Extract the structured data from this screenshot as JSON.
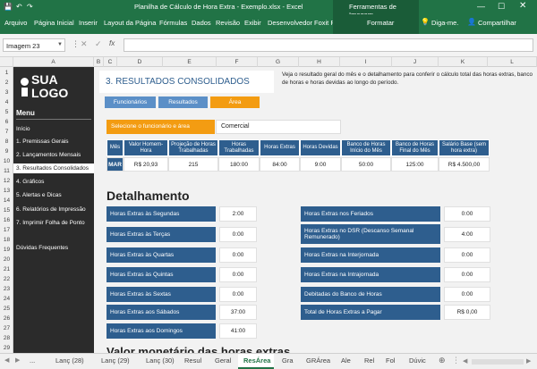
{
  "title_bar": {
    "text": "Planilha de Cálculo de Hora Extra - Exemplo.xlsx - Excel",
    "image_tools": "Ferramentas de Imagem"
  },
  "ribbon": {
    "tabs": [
      "Arquivo",
      "Página Inicial",
      "Inserir",
      "Layout da Página",
      "Fórmulas",
      "Dados",
      "Revisão",
      "Exibir",
      "Desenvolvedor",
      "Foxit PDF",
      "Formatar"
    ],
    "tell_me": "Diga-me.",
    "share": "Compartilhar"
  },
  "formula_bar": {
    "name_box": "Imagem 23",
    "fx": "fx",
    "value": ""
  },
  "columns": [
    "A",
    "B",
    "C",
    "D",
    "E",
    "F",
    "G",
    "H",
    "I",
    "J",
    "K",
    "L"
  ],
  "rows": [
    "1",
    "2",
    "3",
    "4",
    "5",
    "6",
    "7",
    "8",
    "9",
    "10",
    "11",
    "12",
    "13",
    "14",
    "15",
    "16",
    "17",
    "18",
    "19",
    "20",
    "21",
    "22",
    "23",
    "24",
    "25",
    "26",
    "27",
    "28",
    "29"
  ],
  "logo": {
    "line1": "SUA",
    "line2": "LOGO"
  },
  "sidebar": {
    "menu_title": "Menu",
    "items": [
      "Início",
      "1. Premissas Gerais",
      "2. Lançamentos Mensais",
      "3. Resultados Consolidados",
      "4. Gráficos",
      "5. Alertas e Dicas",
      "6. Relatórios de Impressão",
      "7. Imprimir Folha de Ponto",
      "Dúvidas Frequentes"
    ]
  },
  "main": {
    "section_title": "3. RESULTADOS CONSOLIDADOS",
    "description": "Veja o resultado geral do mês e o detalhamento para conferir o cálculo total das horas extras, banco de horas e horas devidas ao longo do período.",
    "buttons": {
      "funcionarios": "Funcionários",
      "resultados": "Resultados",
      "area": "Área"
    },
    "selector": {
      "label": "Selecione o funcionário e área",
      "value": "Comercial"
    },
    "table": {
      "headers": [
        "Mês",
        "Valor Homem-Hora",
        "Projeção de Horas Trabalhadas",
        "Horas Trabalhadas",
        "Horas Extras",
        "Horas Devidas",
        "Banco de Horas Início do Mês",
        "Banco de Horas Final do Mês",
        "Salário Base (sem hora extra)"
      ],
      "row": [
        "MAR",
        "R$ 20,93",
        "215",
        "180:00",
        "84:00",
        "9:00",
        "50:00",
        "125:00",
        "R$ 4.500,00"
      ]
    },
    "detail_title": "Detalhamento",
    "detail_left": [
      {
        "label": "Horas Extras às Segundas",
        "value": "2:00"
      },
      {
        "label": "Horas Extras às Terças",
        "value": "0:00"
      },
      {
        "label": "Horas Extras às Quartas",
        "value": "0:00"
      },
      {
        "label": "Horas Extras às Quintas",
        "value": "0:00"
      },
      {
        "label": "Horas Extras às Sextas",
        "value": "0:00"
      },
      {
        "label": "Horas Extras aos Sábados",
        "value": "37:00"
      },
      {
        "label": "Horas Extras aos Domingos",
        "value": "41:00"
      }
    ],
    "detail_right": [
      {
        "label": "Horas Extras nos Feriados",
        "value": "0:00"
      },
      {
        "label": "Horas Extras no DSR (Descanso Semanal Remunerado)",
        "value": "4:00"
      },
      {
        "label": "Horas Extras na Interjornada",
        "value": "0:00"
      },
      {
        "label": "Horas Extras na Intrajornada",
        "value": "0:00"
      },
      {
        "label": "Debitadas do Banco de Horas",
        "value": "0:00"
      },
      {
        "label": "Total de Horas Extras a Pagar",
        "value": "R$ 0,00"
      }
    ],
    "next_title": "Valor monetário das horas extras"
  },
  "sheet_tabs": [
    "Lanç (28)",
    "Lanç (29)",
    "Lanç (30)",
    "Resul",
    "Geral",
    "ResÁrea",
    "Gra",
    "GRÁrea",
    "Ale",
    "Rel",
    "Fol",
    "Dúvic"
  ],
  "colors": {
    "excel_green": "#217346",
    "header_blue": "#2e5e8e",
    "orange": "#f39c12",
    "btn_blue": "#5b8fc7"
  }
}
